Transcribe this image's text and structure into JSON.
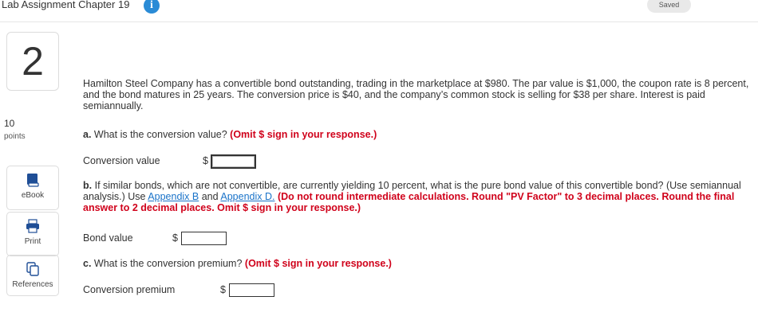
{
  "header": {
    "title": "Lab Assignment Chapter 19",
    "info_icon": "info-icon",
    "status": "Saved"
  },
  "sidebar": {
    "question_number": "2",
    "points_value": "10",
    "points_label": "points",
    "tools": [
      {
        "label": "eBook",
        "icon": "book-icon"
      },
      {
        "label": "Print",
        "icon": "printer-icon"
      },
      {
        "label": "References",
        "icon": "copy-icon"
      }
    ]
  },
  "question": {
    "intro": "Hamilton Steel Company has a convertible bond outstanding, trading in the marketplace at $980. The par value is $1,000, the coupon rate is 8 percent, and the bond matures in 25 years. The conversion price is $40, and the company’s common stock is selling for $38 per share. Interest is paid semiannually.",
    "part_a": {
      "letter": "a.",
      "text": "What is the conversion value?",
      "instruction": "(Omit $ sign in your response.)",
      "field_label": "Conversion value",
      "currency": "$",
      "value": ""
    },
    "part_b": {
      "letter": "b.",
      "text_1": "If similar bonds, which are not convertible, are currently yielding 10 percent, what is the pure bond value of this convertible bond? (Use semiannual analysis.) Use",
      "link_1": "Appendix B",
      "and": "and",
      "link_2": "Appendix D.",
      "instruction": "(Do not round intermediate calculations. Round \"PV Factor\" to 3 decimal places. Round the final answer to 2 decimal places. Omit $ sign in your response.)",
      "field_label": "Bond value",
      "currency": "$",
      "value": ""
    },
    "part_c": {
      "letter": "c.",
      "text": "What is the conversion premium?",
      "instruction": "(Omit $ sign in your response.)",
      "field_label": "Conversion premium",
      "currency": "$",
      "value": ""
    }
  }
}
